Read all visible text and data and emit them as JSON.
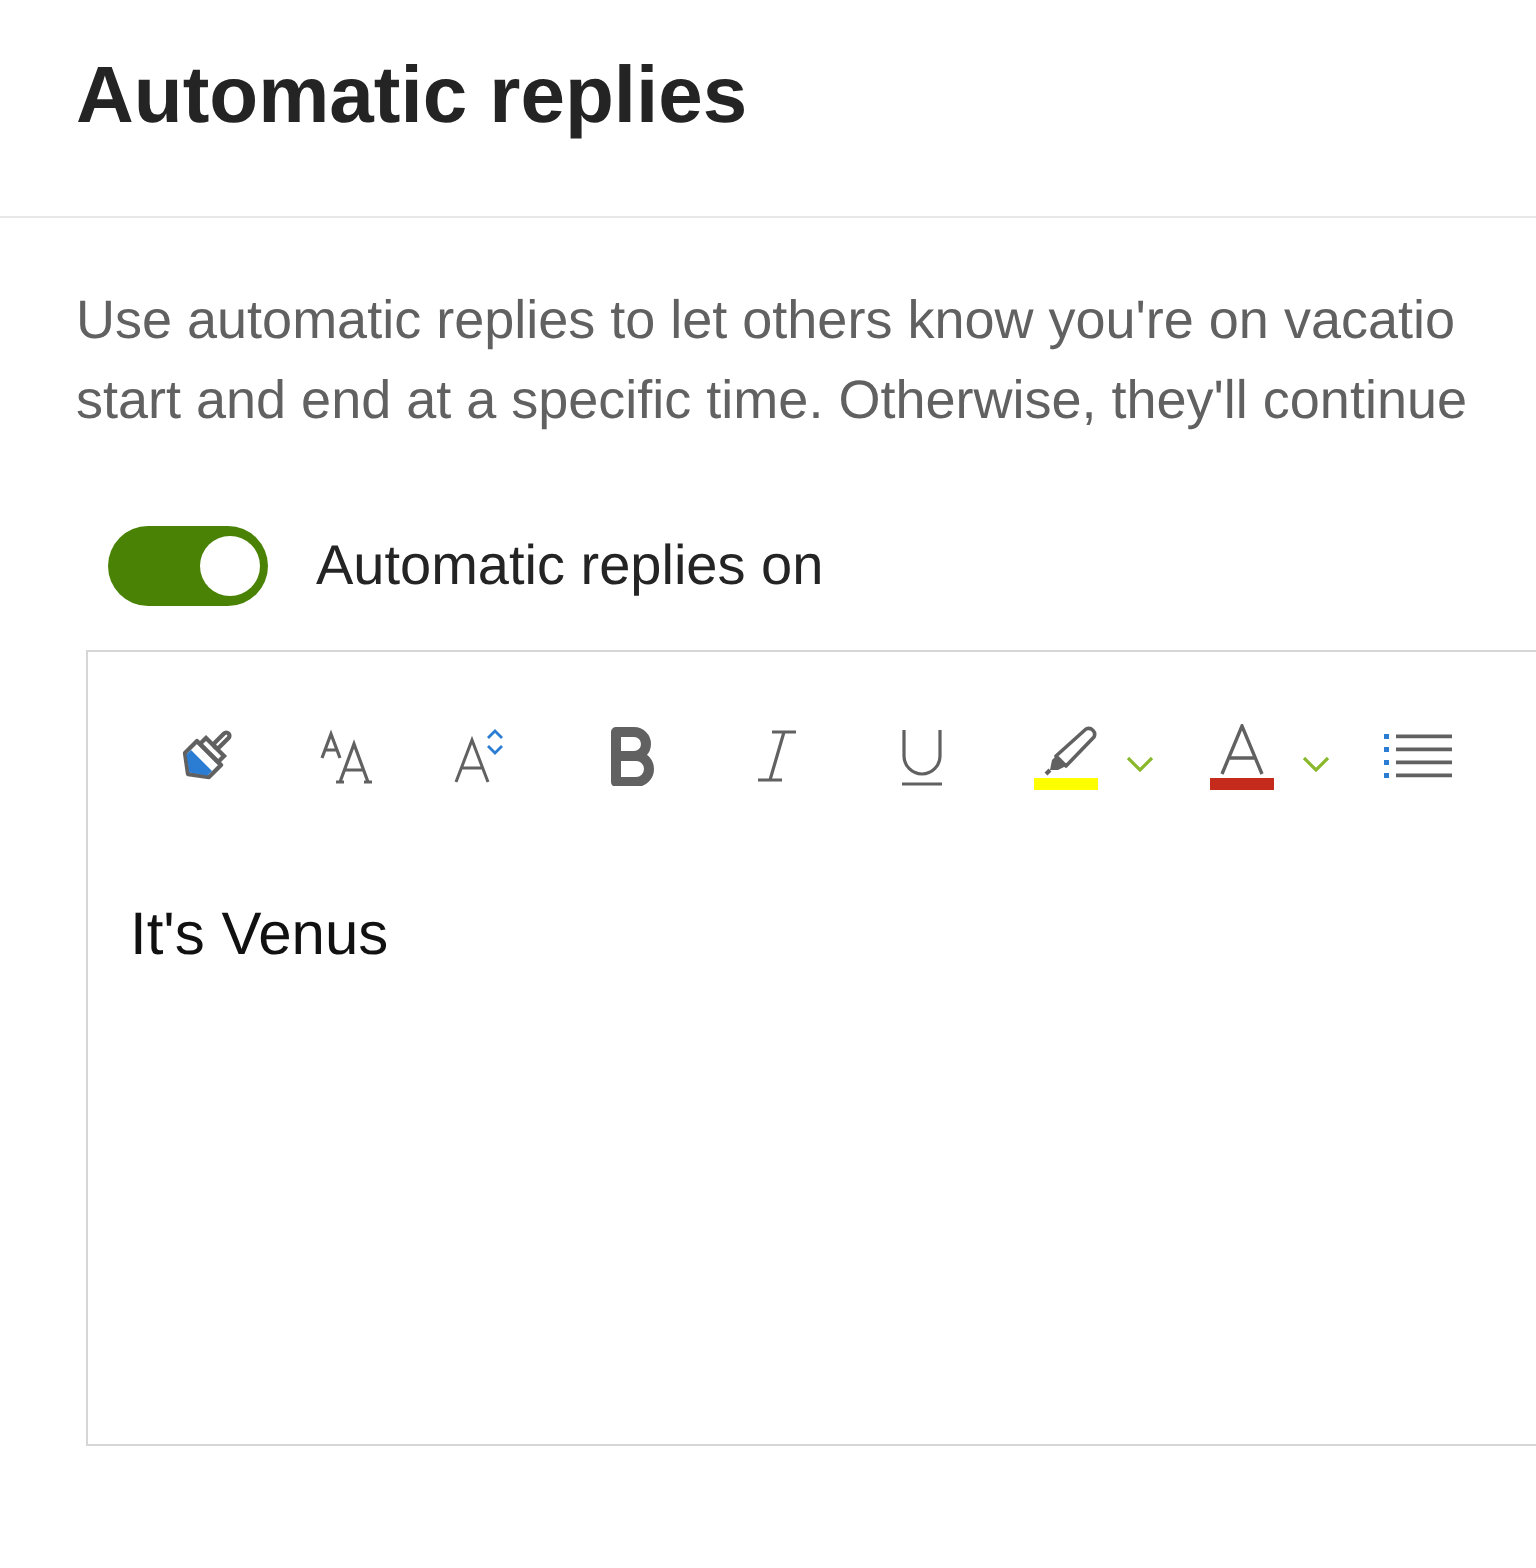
{
  "header": {
    "title": "Automatic replies"
  },
  "description": {
    "lines": [
      "Use automatic replies to let others know you're on vacatio",
      "start and end at a specific time. Otherwise, they'll continue"
    ]
  },
  "toggle": {
    "label": "Automatic replies on",
    "on": true
  },
  "toolbar": [
    {
      "kind": "format-painter"
    },
    {
      "kind": "font-size"
    },
    {
      "kind": "grow-font"
    },
    {
      "kind": "bold"
    },
    {
      "kind": "italic"
    },
    {
      "kind": "underline"
    },
    {
      "kind": "highlight",
      "color": "#ffff00"
    },
    {
      "kind": "font-color",
      "color": "#c42b1c"
    },
    {
      "kind": "bullets"
    }
  ],
  "editor": {
    "value": "It's Venus"
  }
}
